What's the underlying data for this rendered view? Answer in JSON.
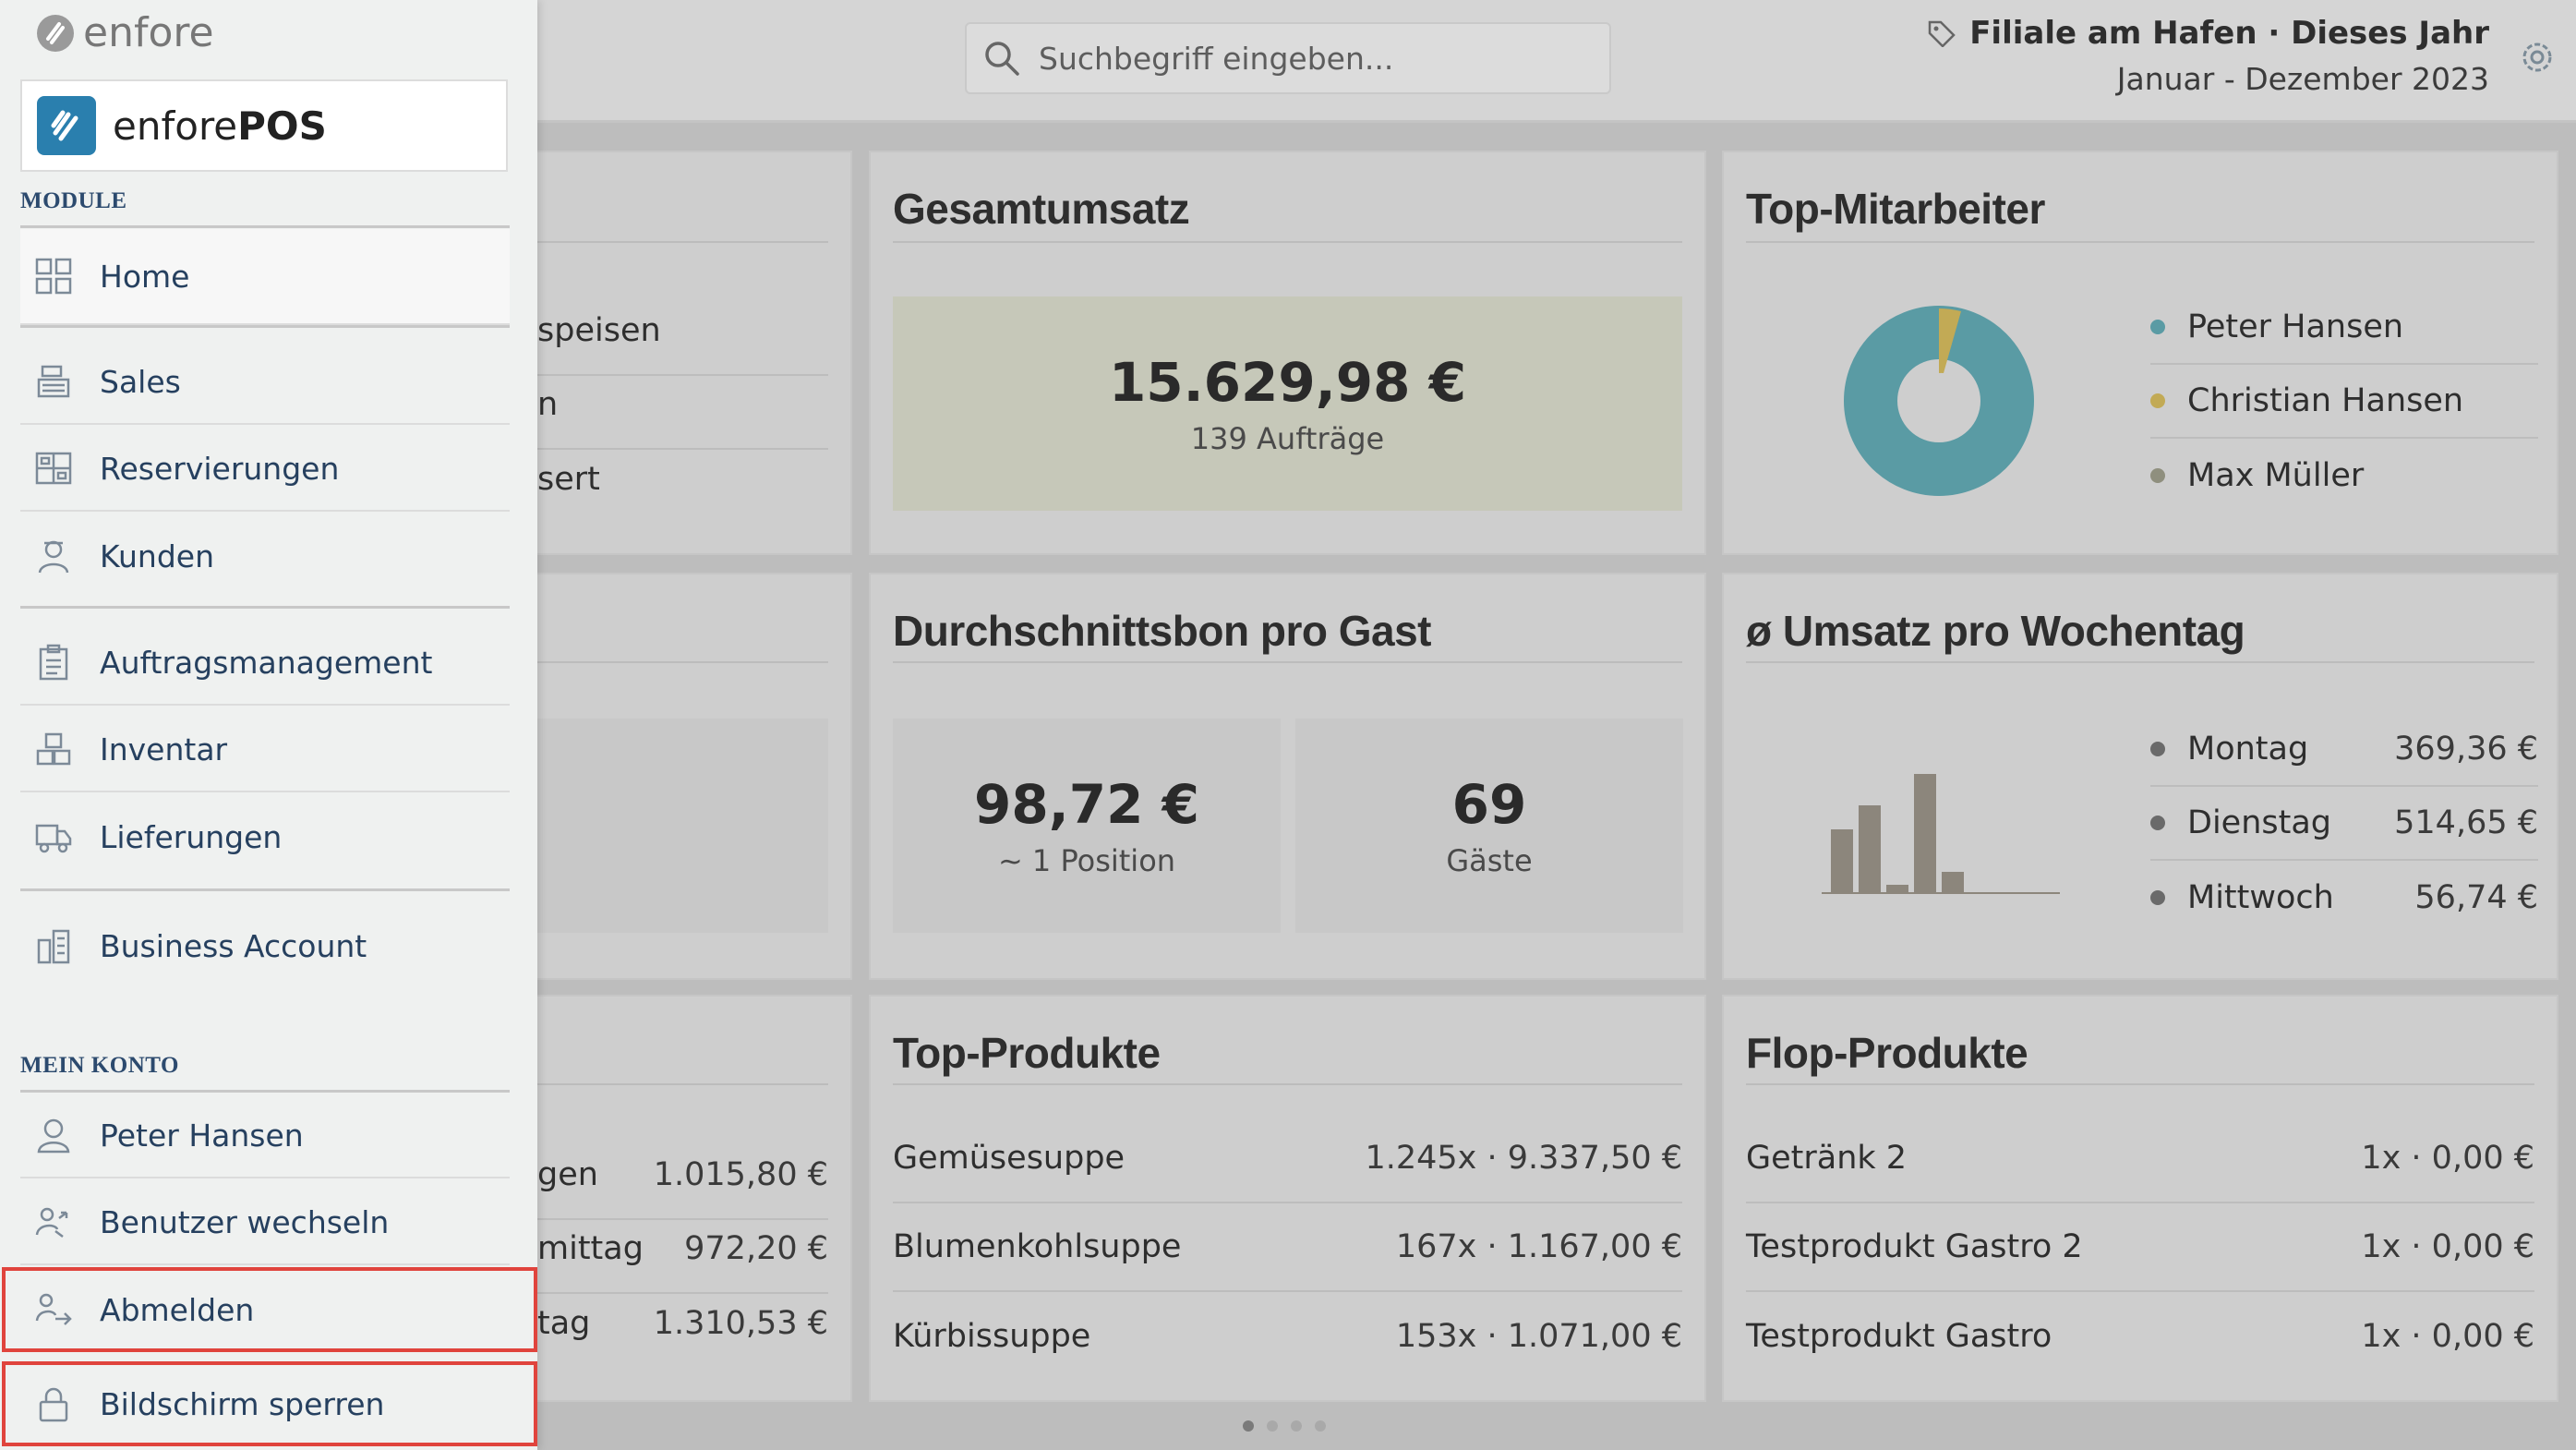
{
  "header": {
    "search_placeholder": "Suchbegriff eingeben...",
    "store_line": "Filiale am Hafen · Dieses Jahr",
    "period": "Januar - Dezember 2023"
  },
  "cards": {
    "gesamtumsatz": {
      "title": "Gesamtumsatz",
      "value": "15.629,98 €",
      "sub": "139 Aufträge"
    },
    "top_mitarbeiter": {
      "title": "Top-Mitarbeiter",
      "legend": [
        {
          "name": "Peter Hansen",
          "color": "#5a9ba4",
          "share": 0.95
        },
        {
          "name": "Christian Hansen",
          "color": "#c2aa55",
          "share": 0.04
        },
        {
          "name": "Max Müller",
          "color": "#8f8f7e",
          "share": 0.01
        }
      ]
    },
    "durchschnittsbon": {
      "title": "Durchschnittsbon pro Gast",
      "value1": "98,72 €",
      "sub1": "~ 1 Position",
      "value2": "69",
      "sub2": "Gäste"
    },
    "wochentag": {
      "title": "ø Umsatz pro Wochentag",
      "legend": [
        {
          "day": "Montag",
          "amount": "369,36 €"
        },
        {
          "day": "Dienstag",
          "amount": "514,65 €"
        },
        {
          "day": "Mittwoch",
          "amount": "56,74 €"
        }
      ]
    },
    "top_produkte": {
      "title": "Top-Produkte",
      "rows": [
        {
          "name": "Gemüsesuppe",
          "value": "1.245x · 9.337,50 €"
        },
        {
          "name": "Blumenkohlsuppe",
          "value": "167x · 1.167,00 €"
        },
        {
          "name": "Kürbissuppe",
          "value": "153x · 1.071,00 €"
        }
      ]
    },
    "flop_produkte": {
      "title": "Flop-Produkte",
      "rows": [
        {
          "name": "Getränk 2",
          "value": "1x · 0,00 €"
        },
        {
          "name": "Testprodukt Gastro 2",
          "value": "1x · 0,00 €"
        },
        {
          "name": "Testprodukt Gastro",
          "value": "1x · 0,00 €"
        }
      ]
    },
    "left_partial_1": {
      "rows": [
        "speisen",
        "n",
        "sert"
      ]
    },
    "left_partial_2": {
      "text": "€"
    },
    "left_partial_3": {
      "rows": [
        {
          "name": "gen",
          "value": "1.015,80 €"
        },
        {
          "name": "mittag",
          "value": "972,20 €"
        },
        {
          "name": "tag",
          "value": "1.310,53 €"
        }
      ]
    }
  },
  "sidebar": {
    "brand": "enfore",
    "app_name_light": "enfore",
    "app_name_bold": "POS",
    "section_modules": "MODULE",
    "section_account": "MEIN KONTO",
    "items": {
      "home": "Home",
      "sales": "Sales",
      "reservierungen": "Reservierungen",
      "kunden": "Kunden",
      "auftragsmanagement": "Auftragsmanagement",
      "inventar": "Inventar",
      "lieferungen": "Lieferungen",
      "business_account": "Business Account",
      "peter_hansen": "Peter Hansen",
      "benutzer_wechseln": "Benutzer wechseln",
      "abmelden": "Abmelden",
      "bildschirm_sperren": "Bildschirm sperren"
    }
  },
  "colors": {
    "accent_blue": "#2a7fae",
    "highlight_red": "#e0443d",
    "pie_main": "#5a9ba4",
    "pie_second": "#c2aa55",
    "bars": "#8c867c"
  }
}
